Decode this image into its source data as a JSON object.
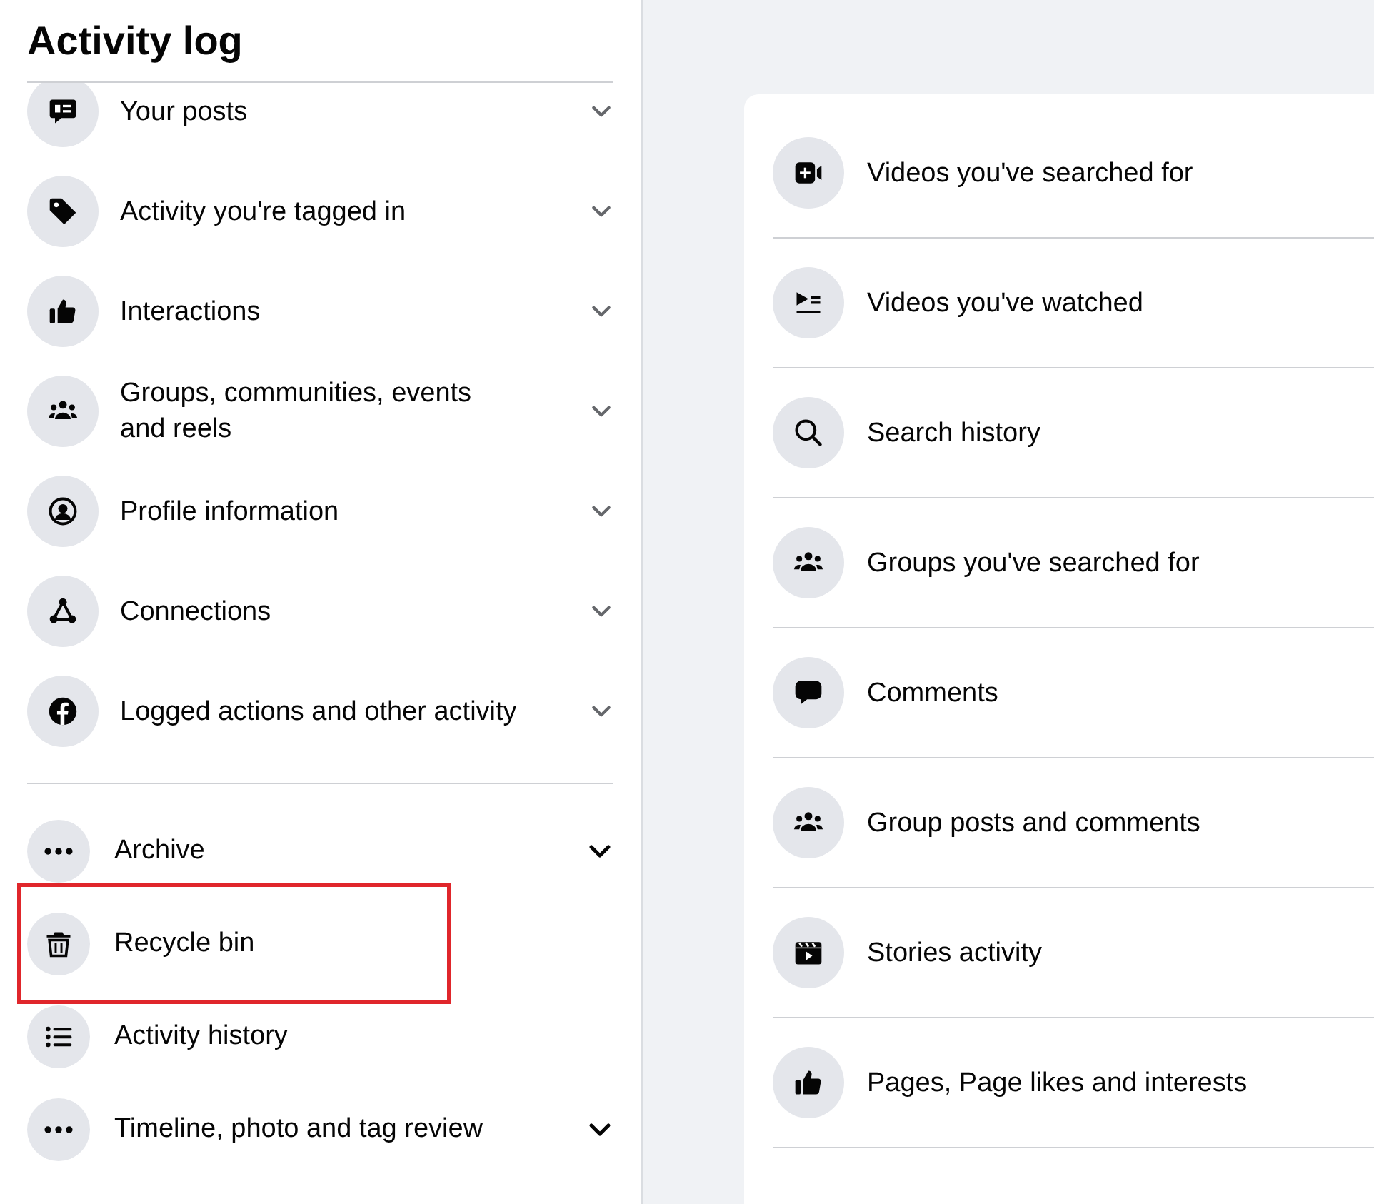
{
  "title": "Activity log",
  "sidebar": {
    "sections": [
      {
        "kind": "categories",
        "items": [
          {
            "label": "Your posts",
            "kind": "posts",
            "expandable": true
          },
          {
            "label": "Activity you're tagged in",
            "kind": "tag",
            "expandable": true
          },
          {
            "label": "Interactions",
            "kind": "thumb",
            "expandable": true
          },
          {
            "label": "Groups, communities, events and reels",
            "kind": "group",
            "expandable": true
          },
          {
            "label": "Profile information",
            "kind": "profile",
            "expandable": true
          },
          {
            "label": "Connections",
            "kind": "connections",
            "expandable": true
          },
          {
            "label": "Logged actions and other activity",
            "kind": "fcircle",
            "expandable": true
          }
        ]
      },
      {
        "kind": "tools",
        "items": [
          {
            "label": "Archive",
            "kind": "dots",
            "expandable": true,
            "highlighted": false
          },
          {
            "label": "Recycle bin",
            "kind": "trash",
            "expandable": false,
            "highlighted": true
          },
          {
            "label": "Activity history",
            "kind": "list",
            "expandable": false,
            "highlighted": false
          },
          {
            "label": "Timeline, photo and tag review",
            "kind": "dots",
            "expandable": true,
            "highlighted": false
          }
        ]
      }
    ]
  },
  "content": {
    "items": [
      {
        "label": "Videos you've searched for",
        "kind": "videoplus"
      },
      {
        "label": "Videos you've watched",
        "kind": "playlist"
      },
      {
        "label": "Search history",
        "kind": "search"
      },
      {
        "label": "Groups you've searched for",
        "kind": "group"
      },
      {
        "label": "Comments",
        "kind": "comment"
      },
      {
        "label": "Group posts and comments",
        "kind": "group"
      },
      {
        "label": "Stories activity",
        "kind": "clapper"
      },
      {
        "label": "Pages, Page likes and interests",
        "kind": "thumb"
      }
    ]
  }
}
